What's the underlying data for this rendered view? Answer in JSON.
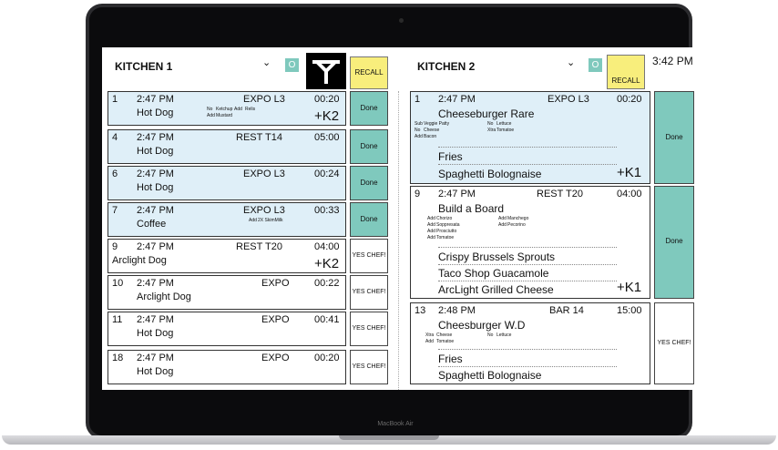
{
  "device": {
    "brand": "MacBook Air"
  },
  "clock": "3:42 PM",
  "kitchen1": {
    "title": "KITCHEN 1",
    "toggle": "O",
    "recall": "RECALL"
  },
  "kitchen2": {
    "title": "KITCHEN 2",
    "toggle": "O",
    "recall": "RECALL"
  },
  "left_tickets": [
    {
      "num": "1",
      "time": "2:47 PM",
      "dest": "EXPO L3",
      "elapsed": "00:20",
      "item": "Hot Dog",
      "mods": [
        "No",
        "Ketchup",
        "Add",
        "Relis",
        "Add",
        "Mustard"
      ],
      "extra": "+K2",
      "action": "Done"
    },
    {
      "num": "4",
      "time": "2:47 PM",
      "dest": "REST T14",
      "elapsed": "05:00",
      "item": "Hot Dog",
      "action": "Done"
    },
    {
      "num": "6",
      "time": "2:47 PM",
      "dest": "EXPO L3",
      "elapsed": "00:24",
      "item": "Hot Dog",
      "action": "Done"
    },
    {
      "num": "7",
      "time": "2:47 PM",
      "dest": "EXPO L3",
      "elapsed": "00:33",
      "item": "Coffee",
      "mods": [
        "Add",
        "2X SkimMilk"
      ],
      "action": "Done"
    },
    {
      "num": "9",
      "time": "2:47 PM",
      "dest": "REST T20",
      "elapsed": "04:00",
      "item": "Arclight Dog",
      "extra": "+K2",
      "action": "YES CHEF!"
    },
    {
      "num": "10",
      "time": "2:47 PM",
      "dest": "EXPO",
      "elapsed": "00:22",
      "item": "Arclight Dog",
      "action": "YES CHEF!"
    },
    {
      "num": "11",
      "time": "2:47 PM",
      "dest": "EXPO",
      "elapsed": "00:41",
      "item": "Hot Dog",
      "action": "YES CHEF!"
    },
    {
      "num": "18",
      "time": "2:47 PM",
      "dest": "EXPO",
      "elapsed": "00:20",
      "item": "Hot Dog",
      "action": "YES CHEF!"
    }
  ],
  "right_tickets": [
    {
      "num": "1",
      "time": "2:47 PM",
      "dest": "EXPO L3",
      "elapsed": "00:20",
      "item": "Cheeseburger Rare",
      "mods": [
        "Sub",
        "Veggie Patty",
        "No",
        "Lettuce",
        "No",
        "Cheese",
        "Xtra",
        "Tomatoe",
        "Add",
        "Bacon"
      ],
      "items2": [
        "Fries",
        "Spaghetti Bolognaise"
      ],
      "extra": "+K1",
      "action": "Done"
    },
    {
      "num": "9",
      "time": "2:47 PM",
      "dest": "REST T20",
      "elapsed": "04:00",
      "item": "Build a Board",
      "mods": [
        "Add",
        "Chorizo",
        "Add",
        "Manchego",
        "Add",
        "Soppresata",
        "Add",
        "Pecorino",
        "Add",
        "Prosciutto",
        "Add",
        "Tomatoe"
      ],
      "items2": [
        "Crispy Brussels Sprouts",
        "Taco Shop Guacamole",
        "ArcLight Grilled Cheese"
      ],
      "extra": "+K1",
      "action": "Done"
    },
    {
      "num": "13",
      "time": "2:48 PM",
      "dest": "BAR 14",
      "elapsed": "15:00",
      "item": "Cheesburger W.D",
      "mods": [
        "Xtra",
        "Cheese",
        "No",
        "Lettuce",
        "Add",
        "Tomatoe"
      ],
      "items2": [
        "Fries",
        "Spaghetti Bolognaise"
      ],
      "action": "YES CHEF!"
    }
  ]
}
